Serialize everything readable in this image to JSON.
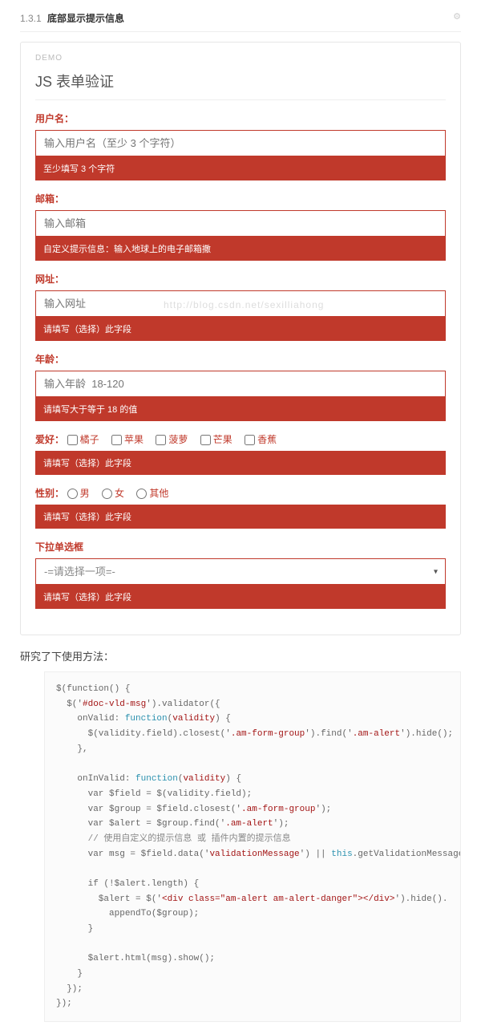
{
  "header": {
    "num": "1.3.1",
    "title": "底部显示提示信息"
  },
  "demo": {
    "tag": "DEMO",
    "title": "JS 表单验证",
    "username": {
      "label": "用户名：",
      "placeholder": "输入用户名（至少 3 个字符）",
      "alert": "至少填写 3 个字符"
    },
    "email": {
      "label": "邮箱：",
      "placeholder": "输入邮箱",
      "alert": "自定义提示信息：输入地球上的电子邮箱撒"
    },
    "url": {
      "label": "网址：",
      "placeholder": "输入网址",
      "alert": "请填写（选择）此字段",
      "watermark": "http://blog.csdn.net/sexilliahong"
    },
    "age": {
      "label": "年龄：",
      "placeholder": "输入年龄  18-120",
      "alert": "请填写大于等于 18 的值"
    },
    "hobby": {
      "label": "爱好：",
      "options": [
        "橘子",
        "苹果",
        "菠萝",
        "芒果",
        "香蕉"
      ],
      "alert": "请填写（选择）此字段"
    },
    "gender": {
      "label": "性别：",
      "options": [
        "男",
        "女",
        "其他"
      ],
      "alert": "请填写（选择）此字段"
    },
    "select": {
      "label": "下拉单选框",
      "placeholder": "-=请选择一项=-",
      "alert": "请填写（选择）此字段"
    }
  },
  "note": "研究了下使用方法：",
  "code": {
    "l1": "$(function() {",
    "l2a": "  $('",
    "l2b": "#doc-vld-msg",
    "l2c": "').validator({",
    "l3a": "    onValid: ",
    "l3b": "function",
    "l3c": "(",
    "l3d": "validity",
    "l3e": ") {",
    "l4a": "      $(validity.field).closest('",
    "l4b": ".am-form-group",
    "l4c": "').find('",
    "l4d": ".am-alert",
    "l4e": "').hide();",
    "l5": "    },",
    "l6": "",
    "l7a": "    onInValid: ",
    "l7b": "function",
    "l7c": "(",
    "l7d": "validity",
    "l7e": ") {",
    "l8a": "      var $field = $(validity.field);",
    "l9a": "      var $group = $field.closest('",
    "l9b": ".am-form-group",
    "l9c": "');",
    "l10a": "      var $alert = $group.find('",
    "l10b": ".am-alert",
    "l10c": "');",
    "l11": "      // 使用自定义的提示信息 或 插件内置的提示信息",
    "l12a": "      var msg = $field.data('",
    "l12b": "validationMessage",
    "l12c": "') || ",
    "l12d": "this",
    "l12e": ".getValidationMessage(validity);",
    "l13": "",
    "l14": "      if (!$alert.length) {",
    "l15a": "        $alert = $('",
    "l15b": "<div class=\"am-alert am-alert-danger\"></div>",
    "l15c": "').hide().",
    "l16": "          appendTo($group);",
    "l17": "      }",
    "l18": "",
    "l19": "      $alert.html(msg).show();",
    "l20": "    }",
    "l21": "  });",
    "l22": "});"
  }
}
